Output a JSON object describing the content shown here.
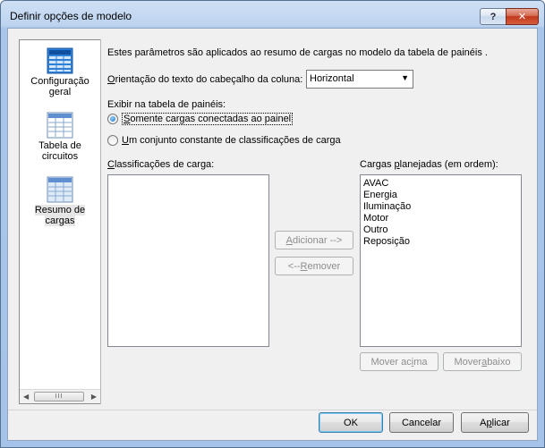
{
  "window": {
    "title": "Definir opções de modelo",
    "help_label": "?",
    "close_label": "✕"
  },
  "sidebar": {
    "items": [
      {
        "line1": "Configuração",
        "line2": "geral",
        "icon": "layout-grid-icon",
        "selected": false
      },
      {
        "line1": "Tabela de",
        "line2": "circuitos",
        "icon": "table-icon",
        "selected": false
      },
      {
        "line1": "Resumo de",
        "line2": "cargas",
        "icon": "table-icon",
        "selected": true
      }
    ],
    "scroll_left": "◀",
    "scroll_right": "▶",
    "scroll_grip": "III"
  },
  "content": {
    "intro": "Estes parâmetros são aplicados ao resumo de cargas no modelo da tabela de painéis .",
    "orientation": {
      "label_prefix": "O",
      "label_rest": "rientação do texto do cabeçalho da coluna:",
      "value": "Horizontal"
    },
    "exibir_label": "Exibir na tabela de painéis:",
    "radio_connected": {
      "mnemonic": "S",
      "rest": "omente cargas conectadas ao painel",
      "checked": true
    },
    "radio_constant": {
      "mnemonic": "U",
      "rest": "m conjunto constante de classificações de carga",
      "checked": false
    },
    "classif": {
      "mnemonic": "C",
      "rest": "lassificações de carga:"
    },
    "planned": {
      "before": "Cargas ",
      "mnemonic": "p",
      "rest": "lanejadas (em ordem):",
      "items": [
        "AVAC",
        "Energia",
        "Iluminação",
        "Motor",
        "Outro",
        "Reposição"
      ]
    },
    "add_button": {
      "mnemonic": "A",
      "rest": "dicionar -->"
    },
    "remove_button": {
      "before": "<-- ",
      "mnemonic": "R",
      "rest": "emover"
    },
    "move_up": {
      "before": "Mover ac",
      "mnemonic": "i",
      "rest": "ma"
    },
    "move_down": {
      "before": "Mover ",
      "mnemonic": "a",
      "rest": "baixo"
    }
  },
  "footer": {
    "ok": "OK",
    "cancel": "Cancelar",
    "apply_before": "A",
    "apply_mnemonic": "p",
    "apply_rest": "licar"
  }
}
